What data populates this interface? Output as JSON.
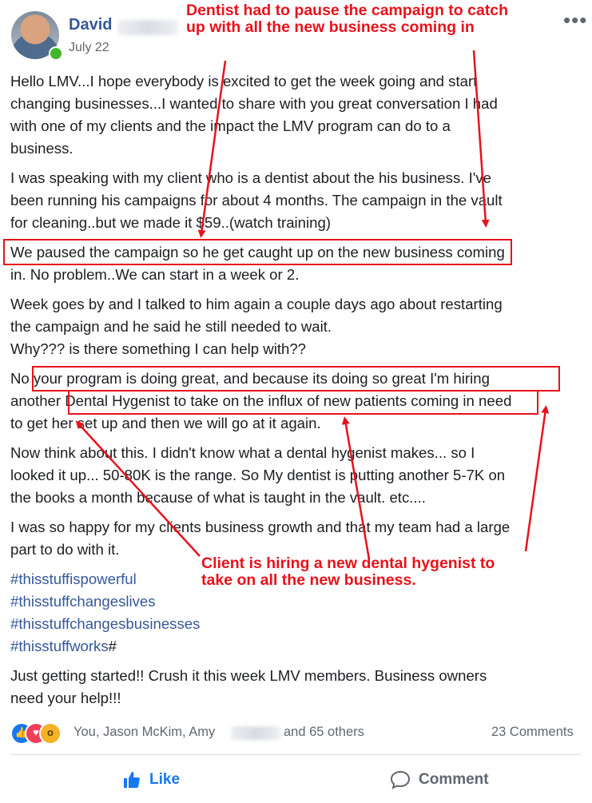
{
  "post": {
    "author_first": "David",
    "date": "July 22",
    "more": "•••",
    "paragraphs": {
      "p1_l1": "Hello LMV...I hope everybody is excited to get the week going and start",
      "p1_l2": "changing businesses...I wanted to share with you great conversation I had",
      "p1_l3": "with one of my clients and the impact the LMV program can do to a",
      "p1_l4": "business.",
      "p2_l1": "I was speaking with my client who is a dentist about the his business. I've",
      "p2_l2": "been running his campaigns for about 4 months. The campaign in the vault",
      "p2_l3": "for cleaning..but we made it $59..(watch training)",
      "p3_l1": "We paused the campaign so he get caught up on the new business coming",
      "p3_l2": "in. No problem..We can start in a week or 2.",
      "p4_l1": "Week goes by and I talked to him again a couple days ago about restarting",
      "p4_l2": "the campaign and he said he still needed to wait.",
      "p4_l3": "Why??? is there something I can help with??",
      "p5_l1": "No your program is doing great, and because its doing so great I'm hiring",
      "p5_l2": "another Dental Hygenist to take on the influx of new patients coming in need",
      "p5_l3": "to get her set up and then we will go at it again.",
      "p6_l1": "Now think about this. I didn't know what a dental hygenist makes... so I",
      "p6_l2": "looked it up... 50-80K is the range. So My dentist is putting another 5-7K on",
      "p6_l3": "the books a month because of what is taught in the vault. etc....",
      "p7_l1": "I was so happy for my clients business growth and that my team had a large",
      "p7_l2": "part to do with it.",
      "p9_l1": "Just getting started!! Crush it this week LMV members. Business owners",
      "p9_l2": "need your help!!!"
    },
    "hashtags": [
      "#thisstuffispowerful",
      "#thisstuffchangeslives",
      "#thisstuffchangesbusinesses",
      "#thisstuffworks"
    ],
    "hashtag_suffix": "#"
  },
  "annotations": {
    "callout_top_l1": "Dentist had to pause the campaign to catch",
    "callout_top_l2": "up with all the new business coming in",
    "callout_bottom_l1": "Client is hiring a new dental hygenist to",
    "callout_bottom_l2": "take on all the new business.",
    "color": "#e8121b"
  },
  "footer": {
    "reactions_prefix": "You, Jason McKim, Amy",
    "reactions_suffix": "and 65 others",
    "comments": "23 Comments",
    "like_label": "Like",
    "comment_label": "Comment",
    "reaction_icons": [
      "like-icon",
      "love-icon",
      "wow-icon"
    ],
    "link_color": "#365899",
    "like_color": "#1877f2"
  }
}
